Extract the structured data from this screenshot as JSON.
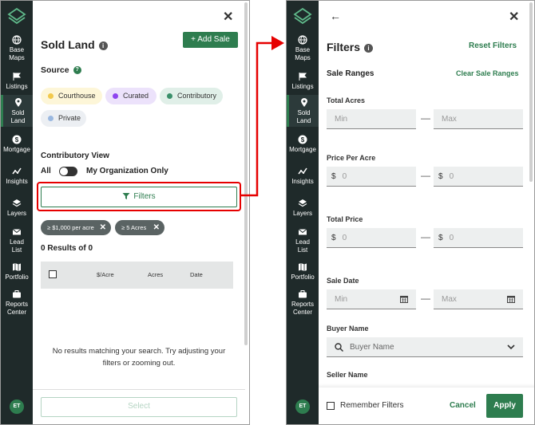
{
  "rail": {
    "items": [
      {
        "label1": "Base",
        "label2": "Maps",
        "icon": "globe-icon"
      },
      {
        "label1": "Listings",
        "label2": "",
        "icon": "flag-icon"
      },
      {
        "label1": "Sold",
        "label2": "Land",
        "icon": "pin-icon"
      },
      {
        "label1": "Mortgage",
        "label2": "",
        "icon": "dollar-icon"
      },
      {
        "label1": "Insights",
        "label2": "",
        "icon": "trend-icon"
      },
      {
        "label1": "Layers",
        "label2": "",
        "icon": "layers-icon"
      },
      {
        "label1": "Lead",
        "label2": "List",
        "icon": "mail-icon"
      },
      {
        "label1": "Portfolio",
        "label2": "",
        "icon": "map-icon"
      },
      {
        "label1": "Reports",
        "label2": "Center",
        "icon": "briefcase-icon"
      }
    ],
    "avatar": "ET"
  },
  "sold_land": {
    "title": "Sold Land",
    "add_sale": "+ Add Sale",
    "source_label": "Source",
    "chips": [
      {
        "label": "Courthouse",
        "color": "#f2c94c",
        "bg": "#fdf6d8"
      },
      {
        "label": "Curated",
        "color": "#8e44ef",
        "bg": "#ece2fb"
      },
      {
        "label": "Contributory",
        "color": "#3a8f6a",
        "bg": "#e0efe8"
      },
      {
        "label": "Private",
        "color": "#9ab8e0",
        "bg": "#eceff3"
      }
    ],
    "contributory_view": "Contributory View",
    "toggle_all": "All",
    "toggle_org": "My Organization Only",
    "filters_button": "Filters",
    "filter_tags": [
      "≥ $1,000 per acre",
      "≥ 5 Acres"
    ],
    "results": "0 Results of 0",
    "columns": [
      "$/Acre",
      "Acres",
      "Date"
    ],
    "empty_message_line1": "No results matching your search. Try adjusting your",
    "empty_message_line2": "filters or zooming out.",
    "select_button": "Select"
  },
  "filters": {
    "title": "Filters",
    "reset": "Reset Filters",
    "sale_ranges": "Sale Ranges",
    "clear_sale_ranges": "Clear Sale Ranges",
    "total_acres": "Total Acres",
    "min_placeholder": "Min",
    "max_placeholder": "Max",
    "price_per_acre": "Price Per Acre",
    "total_price": "Total Price",
    "currency": "$",
    "zero": "0",
    "sale_date": "Sale Date",
    "buyer_name": "Buyer Name",
    "buyer_placeholder": "Buyer Name",
    "seller_name": "Seller Name",
    "remember_filters": "Remember Filters",
    "cancel": "Cancel",
    "apply": "Apply"
  },
  "colors": {
    "accent": "#2e7d4f",
    "rail": "#1f2a2a",
    "highlight": "#e60000"
  }
}
